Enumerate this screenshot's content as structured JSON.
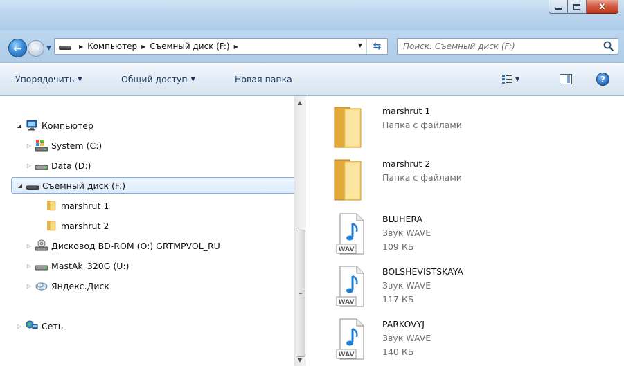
{
  "window": {
    "controls": {
      "minimize": "—",
      "maximize": "□",
      "close": "x"
    }
  },
  "nav": {
    "breadcrumbs": [
      "Компьютер",
      "Съемный диск (F:)"
    ],
    "search_placeholder": "Поиск: Съемный диск (F:)"
  },
  "toolbar": {
    "organize": "Упорядочить",
    "share": "Общий доступ",
    "new_folder": "Новая папка"
  },
  "tree": {
    "computer": "Компьютер",
    "system": "System (C:)",
    "data": "Data (D:)",
    "removable": "Съемный диск (F:)",
    "folder1": "marshrut 1",
    "folder2": "marshrut 2",
    "bd": "Дисковод BD-ROM (O:) GRTMPVOL_RU",
    "mastak": "MastAk_320G (U:)",
    "yandex": "Яндекс.Диск",
    "network": "Сеть"
  },
  "files": [
    {
      "name": "marshrut 1",
      "type": "Папка с файлами",
      "size": "",
      "icon": "folder-icon"
    },
    {
      "name": "marshrut 2",
      "type": "Папка с файлами",
      "size": "",
      "icon": "folder-icon"
    },
    {
      "name": "BLUHERA",
      "type": "Звук WAVE",
      "size": "109 КБ",
      "icon": "wav-file-icon"
    },
    {
      "name": "BOLSHEVISTSKAYA",
      "type": "Звук WAVE",
      "size": "117 КБ",
      "icon": "wav-file-icon"
    },
    {
      "name": "PARKOVYJ",
      "type": "Звук WAVE",
      "size": "140 КБ",
      "icon": "wav-file-icon"
    }
  ],
  "wav_label": "WAV"
}
